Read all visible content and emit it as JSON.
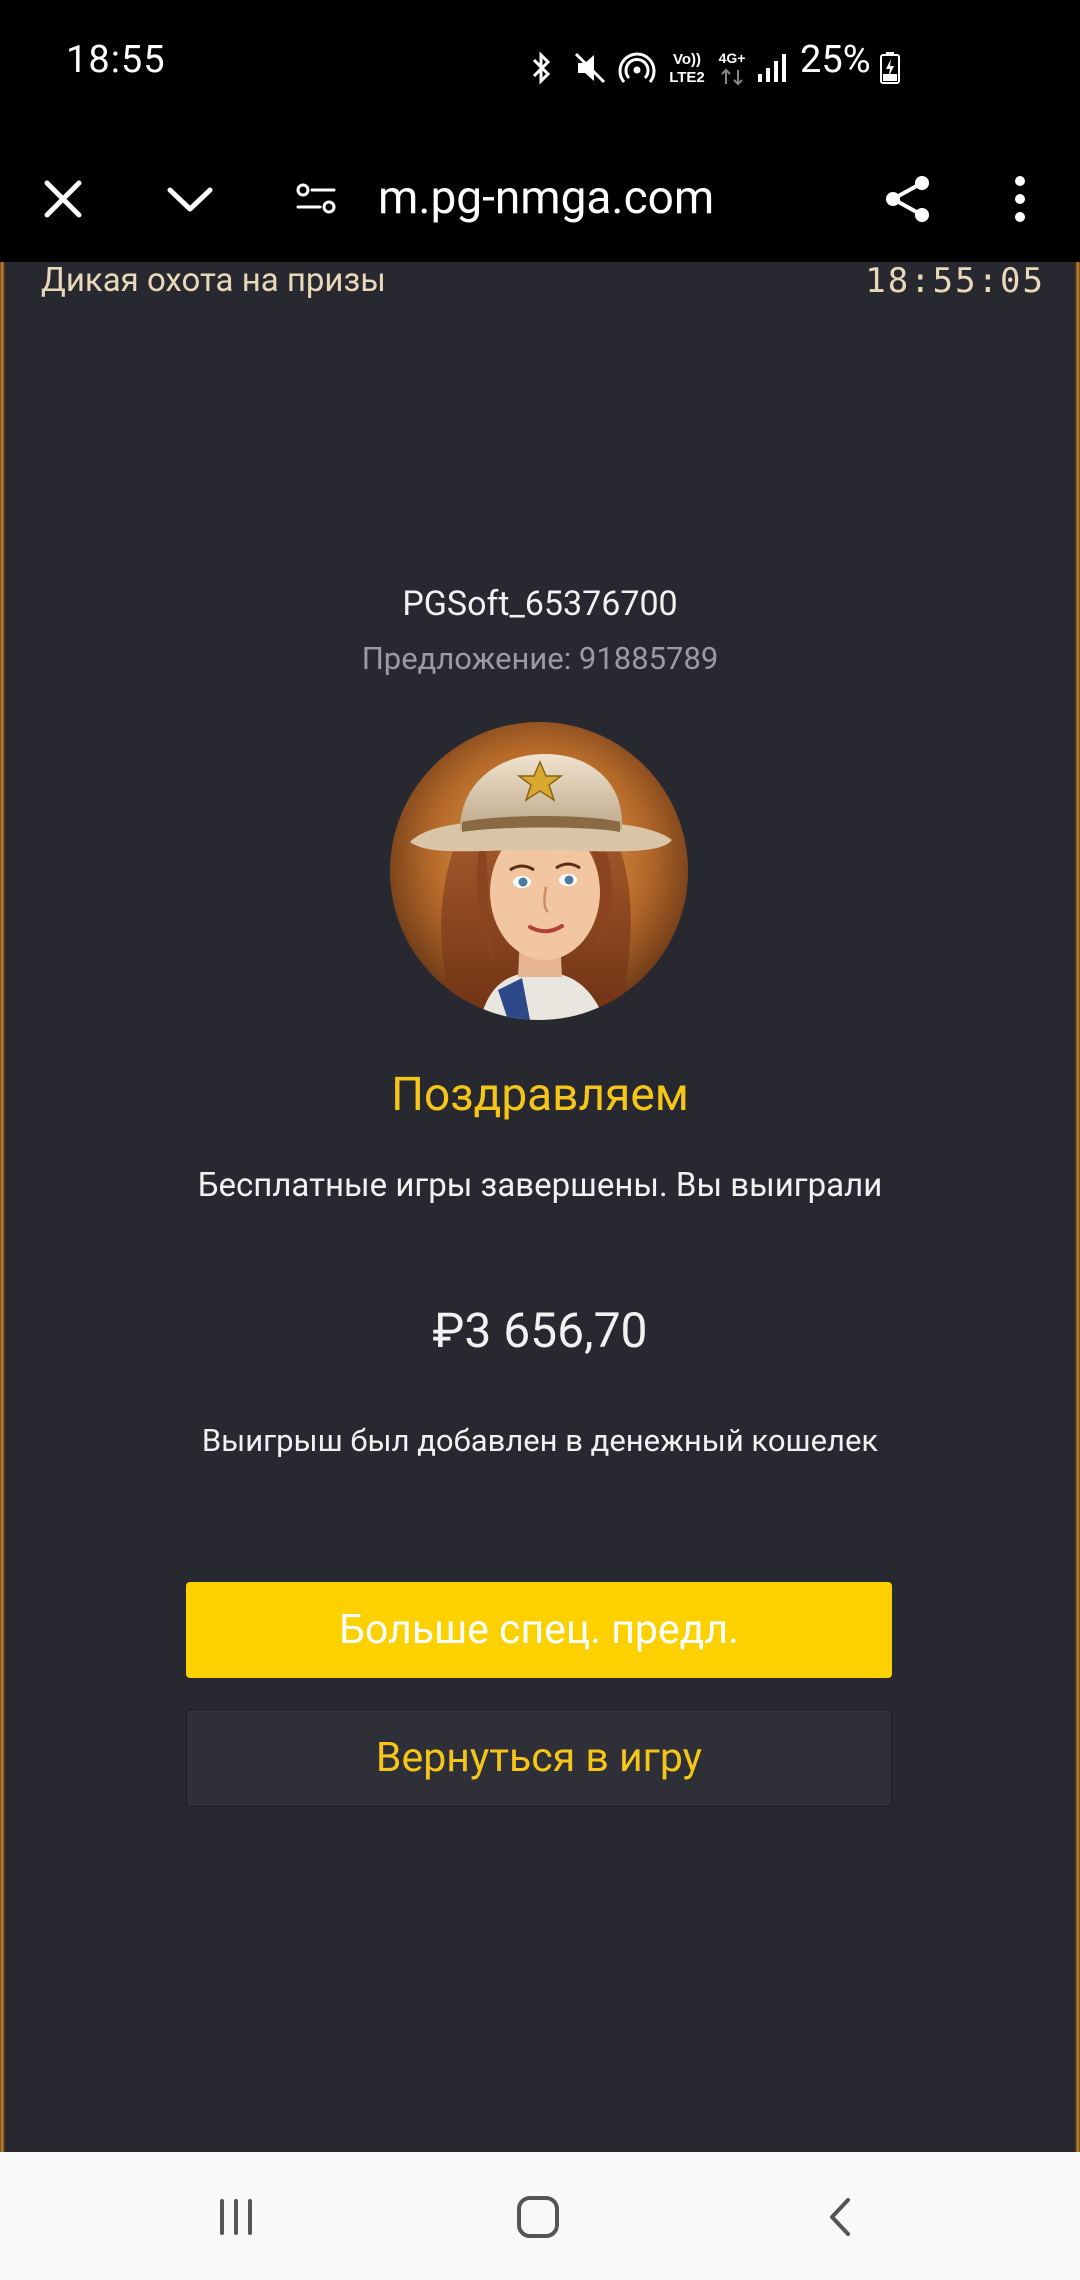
{
  "status_bar": {
    "time": "18:55",
    "network_label_top": "Vo))",
    "network_label_bottom": "LTE2",
    "data_label": "4G+",
    "battery": "25%",
    "icons": [
      "bluetooth-icon",
      "mute-icon",
      "hotspot-icon",
      "volte-icon",
      "data-arrows-icon",
      "signal-icon",
      "battery-charging-icon"
    ]
  },
  "browser": {
    "url": "m.pg-nmga.com",
    "icons": [
      "close-icon",
      "chevron-down-icon",
      "site-settings-icon",
      "share-icon",
      "more-vert-icon"
    ]
  },
  "game": {
    "title": "Дикая охота на призы",
    "clock": "18:55:05"
  },
  "dialog": {
    "username": "PGSoft_65376700",
    "offer": "Предложение: 91885789",
    "congrats": "Поздравляем",
    "description": "Бесплатные игры завершены. Вы выиграли",
    "amount": "₽3 656,70",
    "wallet_note": "Выигрыш был добавлен в денежный кошелек",
    "primary_button": "Больше спец. предл.",
    "secondary_button": "Вернуться в игру"
  },
  "colors": {
    "accent_yellow": "#fdd000",
    "title_yellow": "#f5c518",
    "panel_bg": "#282830"
  },
  "nav_bar": {
    "icons": [
      "recent-apps-icon",
      "home-icon",
      "back-icon"
    ]
  }
}
